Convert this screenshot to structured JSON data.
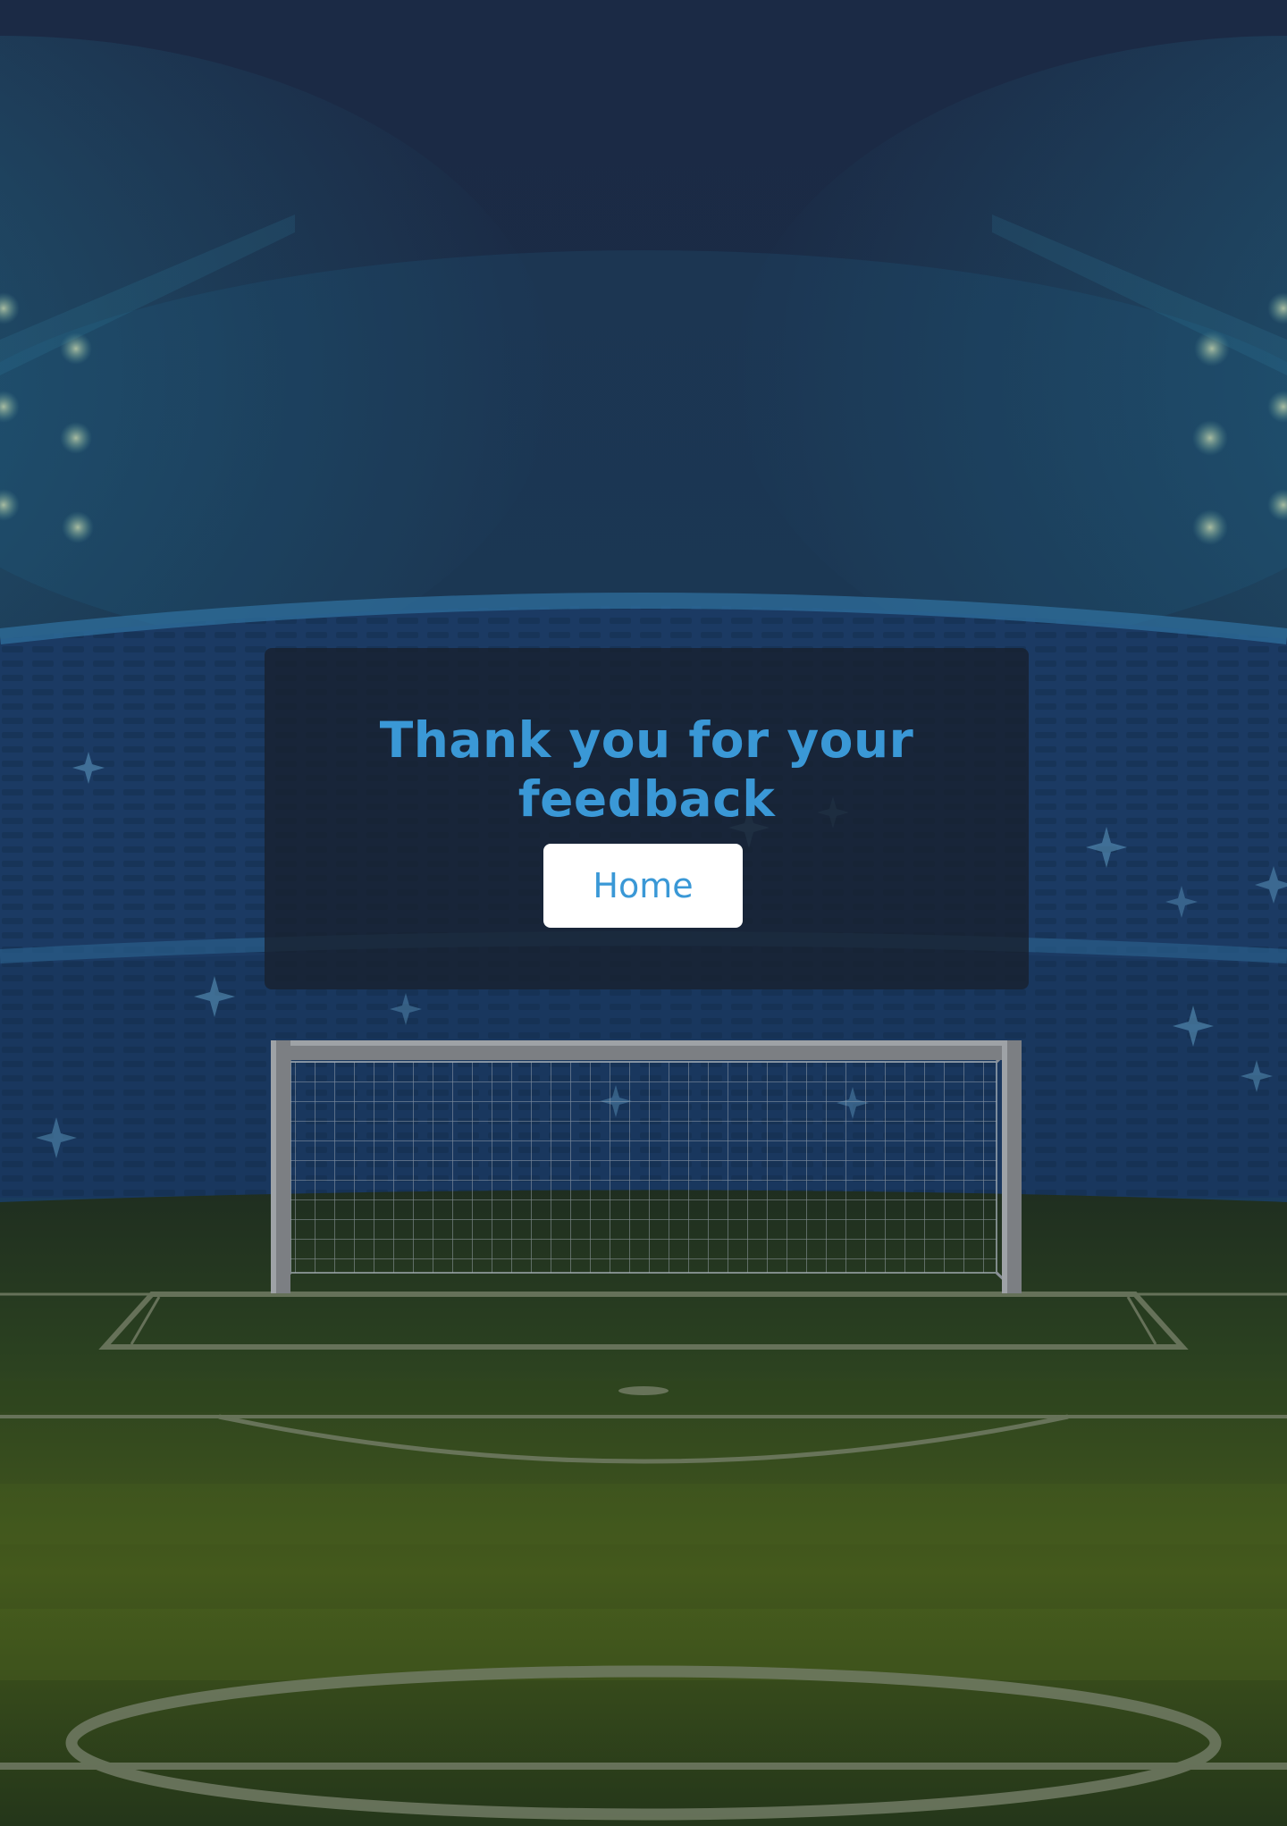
{
  "modal": {
    "title": "Thank you for your feedback",
    "home_button_label": "Home"
  },
  "theme": {
    "accent": "#3a98d6",
    "sky": "#1b2a45",
    "stands": "#1b3a63",
    "pitch": "#3d5a1c"
  }
}
